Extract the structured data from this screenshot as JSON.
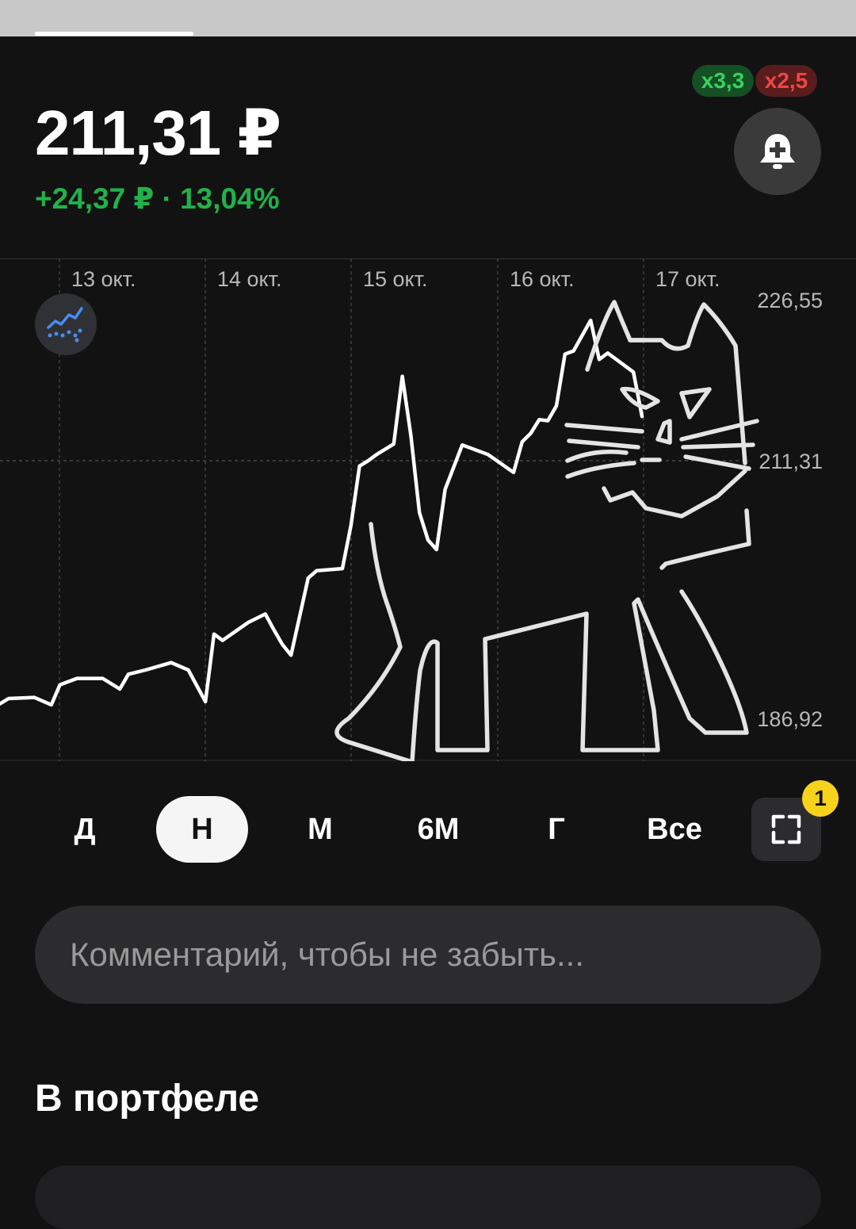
{
  "quote": {
    "price": "211,31 ₽",
    "change": "+24,37 ₽ · 13,04%",
    "change_color": "#21b24b"
  },
  "badges": {
    "buy": "x3,3",
    "sell": "x2,5"
  },
  "icons": {
    "alert": "bell-plus-icon",
    "trend": "trend-analysis-icon",
    "expand": "fullscreen-icon"
  },
  "periods": [
    "Д",
    "Н",
    "М",
    "6М",
    "Г",
    "Все"
  ],
  "selected_period": "Н",
  "notification_count": "1",
  "comment": {
    "placeholder": "Комментарий, чтобы не забыть...",
    "value": ""
  },
  "portfolio": {
    "title": "В портфеле"
  },
  "chart_data": {
    "type": "line",
    "x_tick_labels": [
      "13 окт.",
      "14 окт.",
      "15 окт.",
      "16 окт.",
      "17 окт."
    ],
    "y_tick_labels": [
      "226,55",
      "211,31",
      "186,92"
    ],
    "ylim": [
      186.92,
      226.55
    ],
    "current_value": 211.31,
    "line_color": "#ffffff",
    "grid": true,
    "x": [
      0,
      0.01,
      0.04,
      0.06,
      0.07,
      0.09,
      0.12,
      0.14,
      0.15,
      0.17,
      0.2,
      0.22,
      0.24,
      0.25,
      0.26,
      0.29,
      0.31,
      0.32,
      0.33,
      0.34,
      0.36,
      0.37,
      0.4,
      0.41,
      0.42,
      0.43,
      0.44,
      0.46,
      0.47,
      0.48,
      0.49,
      0.5,
      0.51,
      0.52,
      0.54,
      0.57,
      0.6,
      0.61,
      0.62,
      0.63,
      0.64,
      0.65,
      0.66,
      0.67,
      0.69,
      0.7,
      0.71,
      0.74,
      0.75
    ],
    "y": [
      188.3,
      188.8,
      188.9,
      188.2,
      190.1,
      190.7,
      190.7,
      189.7,
      191.1,
      191.5,
      192.2,
      191.5,
      188.5,
      194.9,
      194.3,
      196,
      196.8,
      195.3,
      193.9,
      192.9,
      200.2,
      200.9,
      201.1,
      205.2,
      210.8,
      211.3,
      211.9,
      212.9,
      219.3,
      213.7,
      206.4,
      203.8,
      202.9,
      208.6,
      212.8,
      211.9,
      210.2,
      213.1,
      213.9,
      215.2,
      215.1,
      216.5,
      221.4,
      221.7,
      224.6,
      220.9,
      221.5,
      219.7,
      215.5
    ]
  }
}
